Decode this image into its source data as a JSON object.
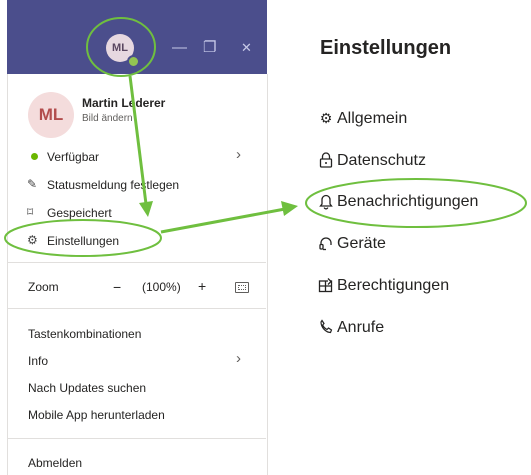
{
  "titlebar": {
    "avatar_initials": "ML",
    "minimize_glyph": "—",
    "restore_glyph": "❐",
    "close_glyph": "✕"
  },
  "profile": {
    "initials": "ML",
    "name": "Martin Lederer",
    "subtitle": "Bild ändern"
  },
  "menu": {
    "status": "Verfügbar",
    "status_message": "Statusmeldung festlegen",
    "saved": "Gespeichert",
    "settings": "Einstellungen",
    "zoom_label": "Zoom",
    "zoom_minus": "−",
    "zoom_value": "(100%)",
    "zoom_plus": "+",
    "shortcuts": "Tastenkombinationen",
    "info": "Info",
    "updates": "Nach Updates suchen",
    "mobile_app": "Mobile App herunterladen",
    "logout": "Abmelden"
  },
  "settings_panel": {
    "title": "Einstellungen",
    "items": [
      {
        "label": "Allgemein",
        "icon": "gear-icon"
      },
      {
        "label": "Datenschutz",
        "icon": "lock-icon"
      },
      {
        "label": "Benachrichtigungen",
        "icon": "bell-icon"
      },
      {
        "label": "Geräte",
        "icon": "headset-icon"
      },
      {
        "label": "Berechtigungen",
        "icon": "permissions-icon"
      },
      {
        "label": "Anrufe",
        "icon": "phone-icon"
      }
    ]
  },
  "colors": {
    "titlebar": "#4b4e8c",
    "annotation_green": "#6fbf3f",
    "status_green": "#6bb700"
  }
}
